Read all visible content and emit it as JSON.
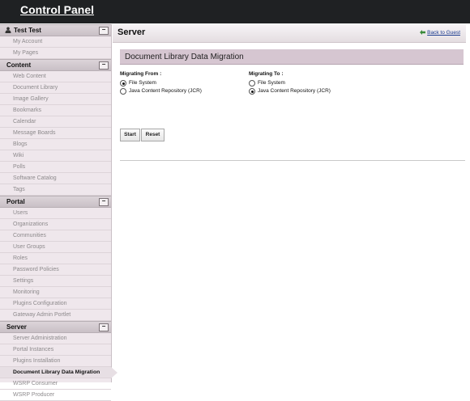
{
  "app": {
    "title": "Control Panel"
  },
  "sidebar": {
    "user": {
      "name": "Test Test",
      "items": [
        "My Account",
        "My Pages"
      ]
    },
    "content": {
      "title": "Content",
      "items": [
        "Web Content",
        "Document Library",
        "Image Gallery",
        "Bookmarks",
        "Calendar",
        "Message Boards",
        "Blogs",
        "Wiki",
        "Polls",
        "Software Catalog",
        "Tags"
      ]
    },
    "portal": {
      "title": "Portal",
      "items": [
        "Users",
        "Organizations",
        "Communities",
        "User Groups",
        "Roles",
        "Password Policies",
        "Settings",
        "Monitoring",
        "Plugins Configuration",
        "Gateway Admin Portlet"
      ]
    },
    "server": {
      "title": "Server",
      "items": [
        "Server Administration",
        "Portal Instances",
        "Plugins Installation",
        "Document Library Data Migration",
        "WSRP Consumer",
        "WSRP Producer"
      ],
      "active_index": 3
    },
    "collapse_symbol": "−"
  },
  "main": {
    "heading": "Server",
    "back_link": "Back to Guest",
    "panel_title": "Document Library Data Migration",
    "migrating_from": {
      "label": "Migrating From :",
      "options": [
        "File System",
        "Java Content Repository (JCR)"
      ],
      "selected": 0
    },
    "migrating_to": {
      "label": "Migrating To :",
      "options": [
        "File System",
        "Java Content Repository (JCR)"
      ],
      "selected": 1
    },
    "buttons": {
      "start": "Start",
      "reset": "Reset"
    }
  },
  "colors": {
    "topbar": "#1f2123",
    "sidebar_bg": "#efe7ec",
    "panel_title_bg": "#d6c6d1",
    "link": "#1a3a8f"
  }
}
